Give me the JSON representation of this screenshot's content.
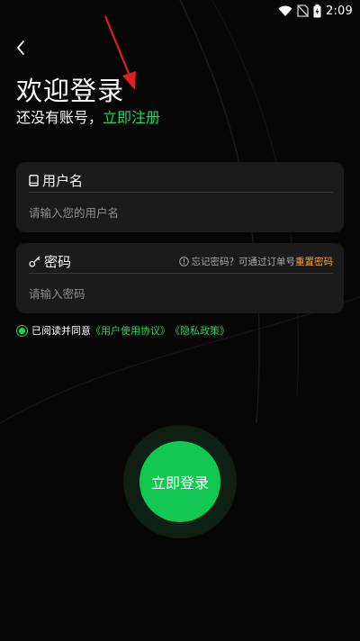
{
  "status_bar": {
    "time": "2:09"
  },
  "header": {
    "title": "欢迎登录",
    "subtitle_prefix": "还没有账号，",
    "register_link": "立即注册"
  },
  "username": {
    "label": "用户名",
    "placeholder": "请输入您的用户名",
    "icon": "phone-icon"
  },
  "password": {
    "label": "密码",
    "placeholder": "请输入密码",
    "icon": "key-icon",
    "forgot_text": "忘记密码？可通过订单号",
    "reset_link": "重置密码"
  },
  "agreement": {
    "prefix": "已阅读并同意",
    "user_agreement": "《用户使用协议》",
    "privacy_policy": "《隐私政策》",
    "checked": true
  },
  "login_button": {
    "label": "立即登录"
  },
  "colors": {
    "accent": "#1fd665",
    "button": "#12c853",
    "warning_link": "#f3a43c",
    "annotation_arrow": "#e02020",
    "card_bg": "#1b1b1b"
  }
}
